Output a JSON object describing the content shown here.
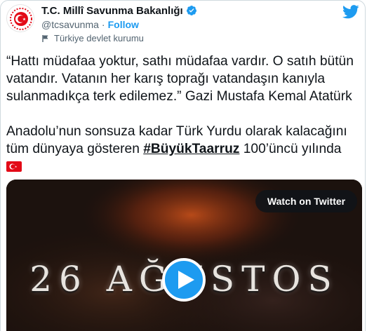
{
  "account": {
    "name": "T.C. Millî Savunma Bakanlığı",
    "handle": "@tcsavunma",
    "separator": "·",
    "follow_label": "Follow",
    "affiliation_label": "Türkiye devlet kurumu"
  },
  "tweet": {
    "quote_text": "“Hattı müdafaa yoktur, sathı müdafaa vardır. O satıh bütün vatandır. Vatanın her karış toprağı vatandaşın kanıyla sulanmadıkça terk edilemez.” Gazi Mustafa Kemal Atatürk",
    "line2_before": "Anadolu’nun sonsuza kadar Türk Yurdu olarak kalacağını tüm dünyaya gösteren ",
    "hashtag": "#BüyükTaarruz",
    "line2_after": " 100’üncü yılında",
    "flag_emoji": "turkey-flag-icon"
  },
  "media": {
    "title_text": "26 AĞUSTOS",
    "watch_label": "Watch on Twitter",
    "play_icon": "play-icon"
  },
  "colors": {
    "accent": "#1d9bf0",
    "text": "#0f1419",
    "secondary": "#536471",
    "border": "#cfd9de",
    "turkey_red": "#e30a17"
  }
}
